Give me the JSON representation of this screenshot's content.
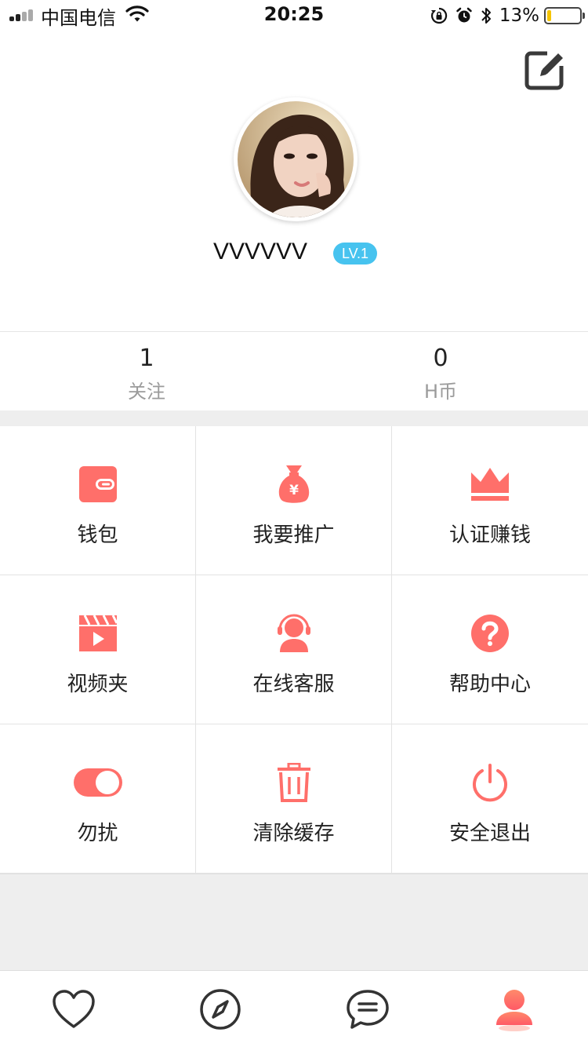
{
  "status_bar": {
    "carrier": "中国电信",
    "time": "20:25",
    "battery_percent": "13%",
    "battery_level": 0.13,
    "icons": [
      "signal-icon",
      "wifi-icon",
      "rotation-lock-icon",
      "alarm-icon",
      "bluetooth-icon",
      "battery-icon"
    ]
  },
  "profile": {
    "username": "VVVVVV",
    "level": "LV.1",
    "edit_icon": "edit-icon",
    "avatar": "avatar"
  },
  "stats": [
    {
      "value": "1",
      "label": "关注"
    },
    {
      "value": "0",
      "label": "H币"
    }
  ],
  "menu": [
    {
      "label": "钱包",
      "icon": "wallet-icon"
    },
    {
      "label": "我要推广",
      "icon": "money-bag-icon"
    },
    {
      "label": "认证赚钱",
      "icon": "crown-icon"
    },
    {
      "label": "视频夹",
      "icon": "video-folder-icon"
    },
    {
      "label": "在线客服",
      "icon": "customer-service-icon"
    },
    {
      "label": "帮助中心",
      "icon": "help-icon"
    },
    {
      "label": "勿扰",
      "icon": "toggle-icon",
      "toggle_on": true
    },
    {
      "label": "清除缓存",
      "icon": "trash-icon"
    },
    {
      "label": "安全退出",
      "icon": "power-icon"
    }
  ],
  "tabbar": {
    "tabs": [
      "heart-icon",
      "compass-icon",
      "chat-icon",
      "profile-icon"
    ],
    "active": "profile-icon"
  },
  "colors": {
    "accent": "#ff6f6a",
    "level_badge": "#47c3ef",
    "muted_text": "#9b9b9b",
    "battery_fill": "#f5c400"
  }
}
